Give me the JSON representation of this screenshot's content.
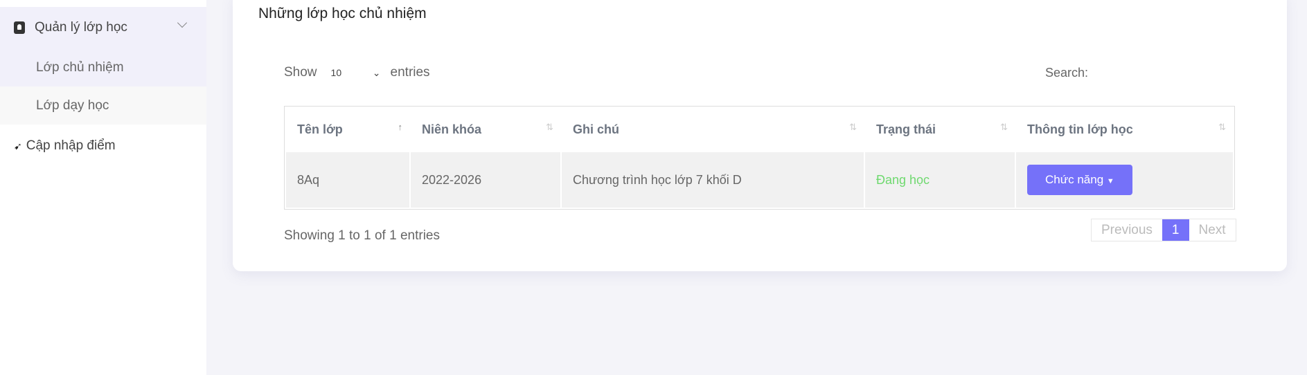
{
  "sidebar": {
    "group_label": "Quản lý lớp học",
    "sub_items": [
      {
        "label": "Lớp chủ nhiệm"
      },
      {
        "label": "Lớp dạy học"
      }
    ],
    "update_label": "Cập nhập điểm"
  },
  "main": {
    "title": "Những lớp học chủ nhiệm",
    "show_label": "Show",
    "page_size": "10",
    "entries_label": "entries",
    "search_label": "Search:",
    "columns": [
      "Tên lớp",
      "Niên khóa",
      "Ghi chú",
      "Trạng thái",
      "Thông tin lớp học"
    ],
    "rows": [
      {
        "name": "8Aq",
        "year": "2022-2026",
        "note": "Chương trình học lớp 7 khối D",
        "status": "Đang học",
        "action": "Chức năng"
      }
    ],
    "info": "Showing 1 to 1 of 1 entries",
    "pagination": {
      "prev": "Previous",
      "current": "1",
      "next": "Next"
    }
  },
  "colors": {
    "accent": "#7571f9",
    "status_active": "#6fd96f"
  }
}
